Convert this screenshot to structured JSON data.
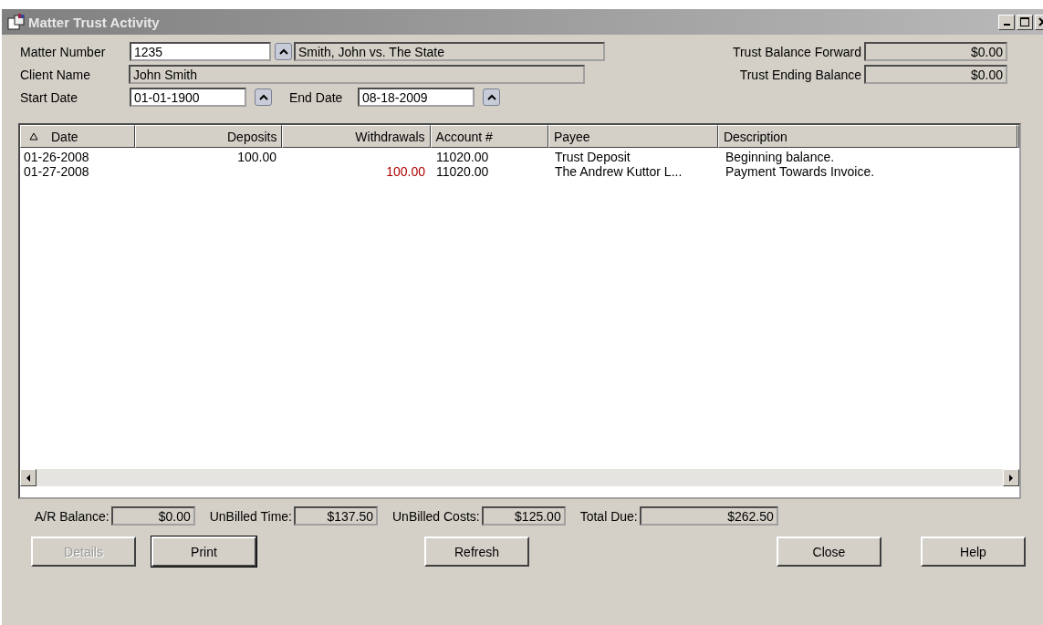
{
  "window": {
    "title": "Matter Trust Activity"
  },
  "matter": {
    "label": "Matter Number",
    "number": "1235",
    "name": "Smith, John vs. The State"
  },
  "client": {
    "label": "Client Name",
    "name": "John Smith"
  },
  "dates": [
    {
      "label": "Start Date",
      "value": "01-01-1900"
    },
    {
      "label": "End Date",
      "value": "08-18-2009"
    }
  ],
  "balances": [
    {
      "label": "Trust Balance Forward",
      "value": "$0.00"
    },
    {
      "label": "Trust Ending Balance",
      "value": "$0.00"
    }
  ],
  "table": {
    "columns": [
      {
        "label": "Date",
        "kind": "text",
        "sorted": true
      },
      {
        "label": "Deposits",
        "kind": "amount",
        "sorted": false
      },
      {
        "label": "Withdrawals",
        "kind": "amount",
        "sorted": false
      },
      {
        "label": "Account #",
        "kind": "text",
        "sorted": false
      },
      {
        "label": "Payee",
        "kind": "text",
        "sorted": false
      },
      {
        "label": "Description",
        "kind": "text",
        "sorted": false
      }
    ],
    "rows": [
      [
        "01-26-2008",
        "100.00",
        "",
        "11020.00",
        "Trust Deposit",
        "Beginning balance."
      ],
      [
        "01-27-2008",
        "",
        "100.00",
        "11020.00",
        "The Andrew Kuttor L...",
        "Payment Towards Invoice."
      ]
    ]
  },
  "totals": [
    {
      "label": "A/R Balance:",
      "value": "$0.00"
    },
    {
      "label": "UnBilled Time:",
      "value": "$137.50"
    },
    {
      "label": "UnBilled Costs:",
      "value": "$125.00"
    },
    {
      "label": "Total Due:",
      "value": "$262.50"
    }
  ],
  "buttons": [
    {
      "label": "Details",
      "disabled": true,
      "default": false
    },
    {
      "label": "Print",
      "disabled": false,
      "default": true
    },
    {
      "label": "Refresh",
      "disabled": false,
      "default": false
    },
    {
      "label": "Close",
      "disabled": false,
      "default": false
    },
    {
      "label": "Help",
      "disabled": false,
      "default": false
    }
  ]
}
